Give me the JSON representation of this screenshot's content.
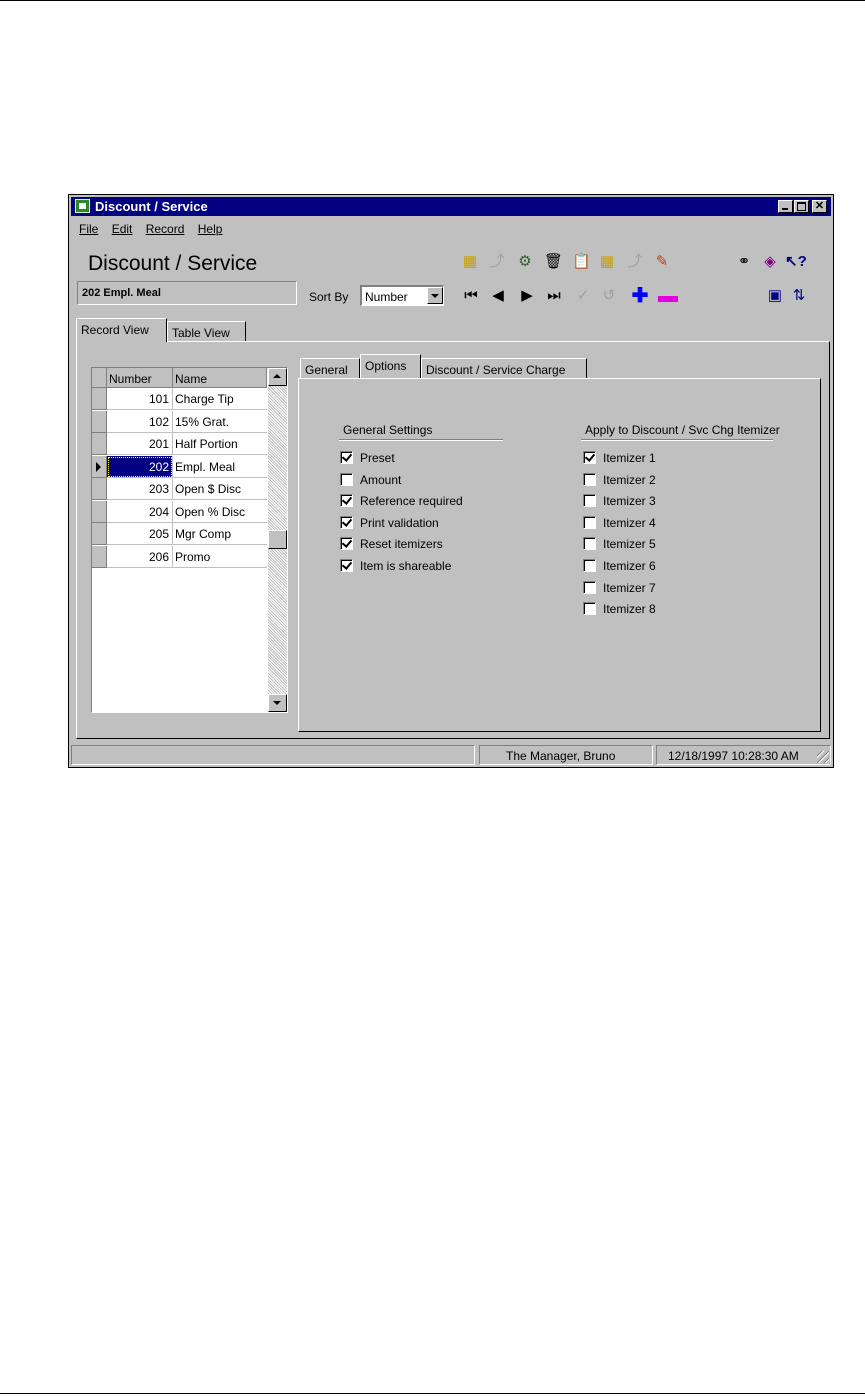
{
  "window": {
    "title": "Discount / Service",
    "menu": [
      "File",
      "Edit",
      "Record",
      "Help"
    ],
    "heading": "Discount / Service",
    "current_record": "202 Empl. Meal"
  },
  "toolbar": {
    "sort_by_label": "Sort By",
    "sort_by_value": "Number",
    "icons": [
      "new-record-icon",
      "copy-record-icon",
      "find-record-icon",
      "delete-icon",
      "clipboard-icon",
      "paste-icon",
      "undo-icon",
      "clear-icon",
      "binoculars-icon",
      "book-icon",
      "help-pointer-icon",
      "first-record-icon",
      "previous-record-icon",
      "next-record-icon",
      "last-record-icon",
      "post-icon",
      "cancel-icon",
      "add-icon",
      "remove-icon",
      "monitor-icon",
      "refresh-icon"
    ]
  },
  "view_tabs": [
    "Record View",
    "Table View"
  ],
  "grid": {
    "columns": [
      "Number",
      "Name"
    ],
    "rows": [
      {
        "number": "101",
        "name": "Charge Tip"
      },
      {
        "number": "102",
        "name": "15% Grat."
      },
      {
        "number": "201",
        "name": "Half Portion"
      },
      {
        "number": "202",
        "name": "Empl. Meal"
      },
      {
        "number": "203",
        "name": "Open $ Disc"
      },
      {
        "number": "204",
        "name": "Open % Disc"
      },
      {
        "number": "205",
        "name": "Mgr Comp"
      },
      {
        "number": "206",
        "name": "Promo"
      }
    ],
    "selected_index": 3
  },
  "detail_tabs": [
    "General",
    "Options",
    "Discount / Service Charge"
  ],
  "active_detail_tab": "Options",
  "general_settings": {
    "title": "General Settings",
    "items": [
      {
        "label": "Preset",
        "checked": true
      },
      {
        "label": "Amount",
        "checked": false
      },
      {
        "label": "Reference required",
        "checked": true
      },
      {
        "label": "Print validation",
        "checked": true
      },
      {
        "label": "Reset itemizers",
        "checked": true
      },
      {
        "label": "Item is shareable",
        "checked": true
      }
    ]
  },
  "itemizers": {
    "title": "Apply to Discount / Svc Chg Itemizer",
    "items": [
      {
        "label": "Itemizer 1",
        "checked": true
      },
      {
        "label": "Itemizer 2",
        "checked": false
      },
      {
        "label": "Itemizer 3",
        "checked": false
      },
      {
        "label": "Itemizer 4",
        "checked": false
      },
      {
        "label": "Itemizer 5",
        "checked": false
      },
      {
        "label": "Itemizer 6",
        "checked": false
      },
      {
        "label": "Itemizer 7",
        "checked": false
      },
      {
        "label": "Itemizer 8",
        "checked": false
      }
    ]
  },
  "status": {
    "user": "The Manager, Bruno",
    "datetime": "12/18/1997 10:28:30 AM"
  },
  "colors": {
    "titlebar": "#000080",
    "face": "#c0c0c0",
    "selection": "#000080"
  }
}
